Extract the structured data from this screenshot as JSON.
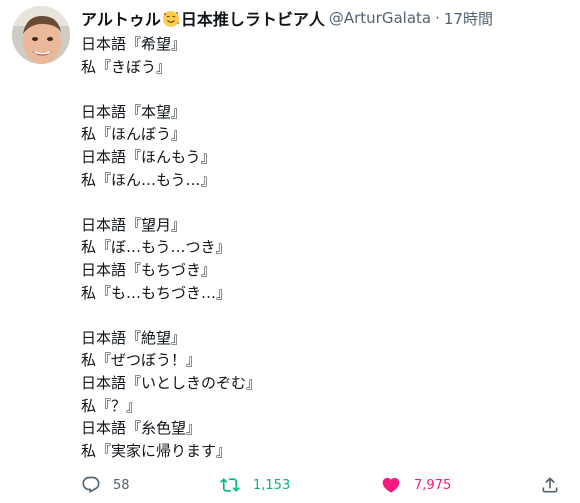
{
  "tweet": {
    "display_name": "アルトゥル",
    "display_name_suffix": "日本推しラトビア人",
    "emoji_icon": "smiling-face-with-hearts-icon",
    "handle": "@ArturGalata",
    "separator": "·",
    "time": "17時間",
    "lines": [
      "日本語『希望』",
      "私『きぼう』",
      "",
      "日本語『本望』",
      "私『ほんぼう』",
      "日本語『ほんもう』",
      "私『ほん…もう…』",
      "",
      "日本語『望月』",
      "私『ぼ…もう…つき』",
      "日本語『もちづき』",
      "私『も…もちづき…』",
      "",
      "日本語『絶望』",
      "私『ぜつぼう！』",
      "日本語『いとしきのぞむ』",
      "私『？』",
      "日本語『糸色望』",
      "私『実家に帰ります』"
    ]
  },
  "actions": {
    "reply_count": "58",
    "retweet_count": "1,153",
    "like_count": "7,975"
  },
  "colors": {
    "text": "#0f1419",
    "secondary": "#536471",
    "retweet_active": "#00ba7c",
    "like_active": "#f91880"
  }
}
